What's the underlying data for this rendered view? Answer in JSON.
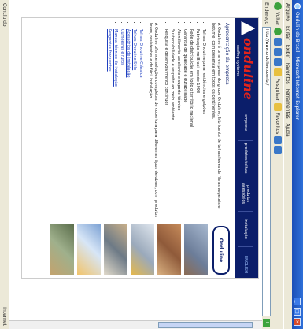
{
  "window": {
    "title": "Ondulin do Brasil - Microsoft Internet Explorer",
    "controls": [
      "_",
      "□",
      "×"
    ]
  },
  "menu": [
    "Arquivo",
    "Editar",
    "Exibir",
    "Favoritos",
    "Ferramentas",
    "Ajuda"
  ],
  "toolbar": {
    "back": "Voltar",
    "search": "Pesquisar",
    "favorites": "Favoritos"
  },
  "address": {
    "label": "Endereço",
    "url": "http://www.onduline.com.br/",
    "go": "Ir"
  },
  "status": {
    "left": "Concluído",
    "right": "Internet"
  },
  "site": {
    "logo_text": "onduline",
    "logo_tagline": "roofing systems",
    "nav": [
      "empresa",
      "produtos telhas",
      "produtos acessórios",
      "instalação",
      "ENGLISH"
    ],
    "heading": "Apresentação da empresa",
    "intro": "A Onduline é uma empresa do grupo Onduline, fabricante de telhas leves de fibras vegetais e betume, com presença em todos os continentes.",
    "list": [
      "Telhas Onduline para residências e galpões",
      "Fabricação no Brasil desde 1993",
      "Rede de distribuição em todo o território nacional",
      "Garantia de qualidade e durabilidade",
      "Atendimento ao cliente e suporte técnico",
      "Sustentabilidade e respeito ao meio ambiente",
      "Pesquisa e desenvolvimento contínuos"
    ],
    "para2": "A Onduline oferece soluções completas de cobertura para diferentes tipos de obras, com produtos leves, resistentes e de fácil instalação.",
    "list2": [
      "Telhas Onduline Clássica",
      "Telhas Onduline Stilo",
      "Acessórios de instalação",
      "Cumeeiras e rufos",
      "Manual técnico de instalação",
      "Perguntas frequentes"
    ],
    "badge": "Onduline"
  }
}
